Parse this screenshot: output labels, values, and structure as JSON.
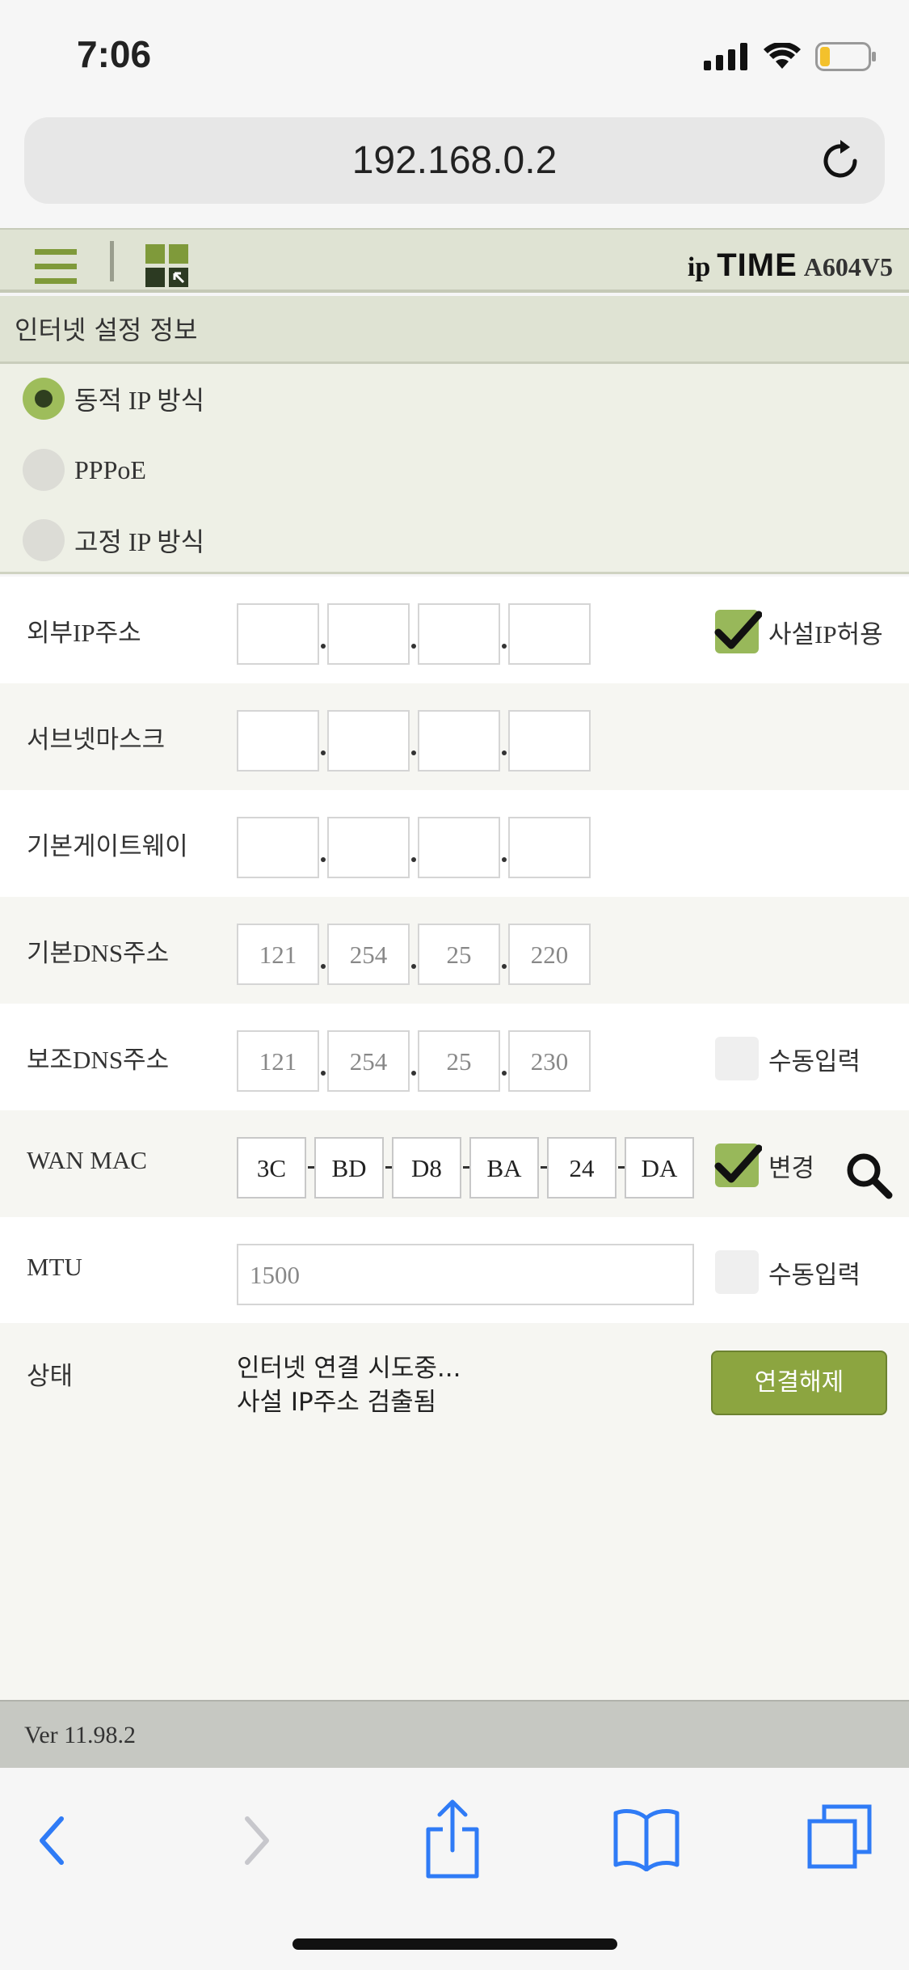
{
  "status_bar": {
    "time": "7:06"
  },
  "browser": {
    "url": "192.168.0.2"
  },
  "header": {
    "brand_ip": "ip",
    "brand_time": "TIME",
    "brand_model": "A604V5"
  },
  "section": {
    "title": "인터넷 설정 정보"
  },
  "connection_types": [
    {
      "label": "동적 IP 방식",
      "selected": true
    },
    {
      "label": "PPPoE",
      "selected": false
    },
    {
      "label": "고정 IP 방식",
      "selected": false
    }
  ],
  "fields": {
    "external_ip": {
      "label": "외부IP주소",
      "octets": [
        "",
        "",
        "",
        ""
      ],
      "option_label": "사설IP허용",
      "option_checked": true
    },
    "subnet_mask": {
      "label": "서브넷마스크",
      "octets": [
        "",
        "",
        "",
        ""
      ]
    },
    "gateway": {
      "label": "기본게이트웨이",
      "octets": [
        "",
        "",
        "",
        ""
      ]
    },
    "dns_primary": {
      "label": "기본DNS주소",
      "octets": [
        "121",
        "254",
        "25",
        "220"
      ]
    },
    "dns_secondary": {
      "label": "보조DNS주소",
      "octets": [
        "121",
        "254",
        "25",
        "230"
      ],
      "option_label": "수동입력",
      "option_checked": false
    },
    "wan_mac": {
      "label": "WAN MAC",
      "parts": [
        "3C",
        "BD",
        "D8",
        "BA",
        "24",
        "DA"
      ],
      "option_label": "변경",
      "option_checked": true
    },
    "mtu": {
      "label": "MTU",
      "placeholder": "1500",
      "option_label": "수동입력",
      "option_checked": false
    }
  },
  "status": {
    "label": "상태",
    "line1": "인터넷 연결 시도중...",
    "line2": "사설 IP주소 검출됨",
    "button": "연결해제"
  },
  "footer": {
    "version": "Ver 11.98.2"
  },
  "colors": {
    "accent": "#8ca540",
    "header_bg": "#dfe3d3",
    "ios_blue": "#2f7bf6"
  }
}
